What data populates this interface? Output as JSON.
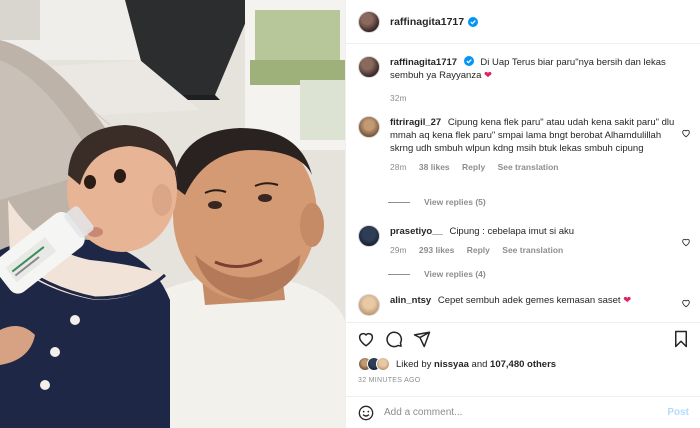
{
  "post": {
    "author": "raffinagita1717",
    "caption_text": "Di Uap Terus biar paru\"nya bersih dan lekas sembuh ya Rayyanza",
    "caption_emoji": "❤",
    "caption_time": "32m"
  },
  "comments": [
    {
      "username": "fitriragil_27",
      "text": "Cipung kena flek paru\" atau udah kena sakit paru\" dlu mmah aq kena flek paru\" smpai lama bngt berobat Alhamdulillah skrng udh smbuh wlpun kdng msih btuk lekas smbuh cipung",
      "time": "28m",
      "likes": "38 likes",
      "reply": "Reply",
      "translate": "See translation",
      "replies": "View replies (5)"
    },
    {
      "username": "prasetiyo__",
      "text": "Cipung : cebelapa imut si aku",
      "time": "29m",
      "likes": "293 likes",
      "reply": "Reply",
      "translate": "See translation",
      "replies": "View replies (4)"
    },
    {
      "username": "alin_ntsy",
      "text": "Cepet sembuh adek gemes kemasan saset",
      "emoji": "❤"
    }
  ],
  "footer": {
    "liked_prefix": "Liked by",
    "liked_user": "nissyaa",
    "liked_and": "and",
    "liked_count": "107,480 others",
    "time_ago": "32 MINUTES AGO",
    "add_comment_placeholder": "Add a comment...",
    "post_label": "Post"
  },
  "colors": {
    "verified": "#0095f6",
    "heart": "#e0245e",
    "muted": "#8e8e8e",
    "post_disabled": "#b3dbff"
  }
}
